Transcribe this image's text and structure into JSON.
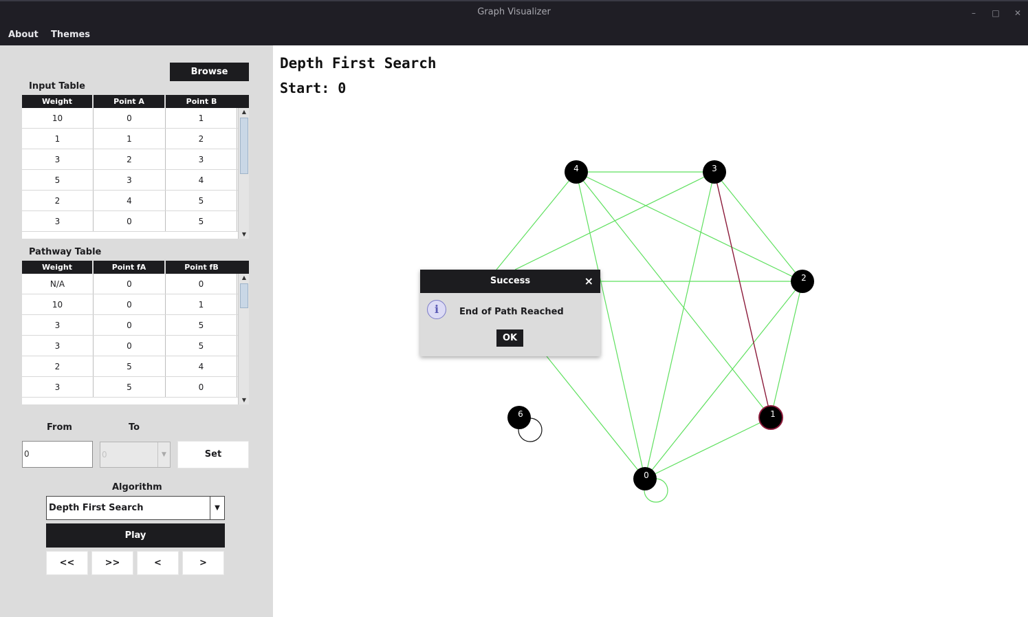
{
  "window": {
    "title": "Graph Visualizer"
  },
  "menu": {
    "about": "About",
    "themes": "Themes"
  },
  "left_panel": {
    "browse_label": "Browse",
    "input_table": {
      "title": "Input Table",
      "columns": [
        "Weight",
        "Point A",
        "Point B"
      ],
      "rows": [
        [
          "10",
          "0",
          "1"
        ],
        [
          "1",
          "1",
          "2"
        ],
        [
          "3",
          "2",
          "3"
        ],
        [
          "5",
          "3",
          "4"
        ],
        [
          "2",
          "4",
          "5"
        ],
        [
          "3",
          "0",
          "5"
        ]
      ]
    },
    "pathway_table": {
      "title": "Pathway Table",
      "columns": [
        "Weight",
        "Point fA",
        "Point fB"
      ],
      "rows": [
        [
          "N/A",
          "0",
          "0"
        ],
        [
          "10",
          "0",
          "1"
        ],
        [
          "3",
          "0",
          "5"
        ],
        [
          "3",
          "0",
          "5"
        ],
        [
          "2",
          "5",
          "4"
        ],
        [
          "3",
          "5",
          "0"
        ]
      ]
    },
    "from_label": "From",
    "to_label": "To",
    "from_value": "0",
    "to_value": "0",
    "set_label": "Set",
    "algorithm_label": "Algorithm",
    "algorithm_selected": "Depth First Search",
    "play_label": "Play",
    "nav_buttons": [
      "<<",
      ">>",
      "<",
      ">"
    ]
  },
  "canvas": {
    "heading": "Depth First Search",
    "start_text": "Start: 0",
    "nodes": [
      "0",
      "1",
      "2",
      "3",
      "4",
      "6"
    ],
    "colors": {
      "edge": "#5ee05e",
      "highlight_edge": "#8b1a3a",
      "node": "#000000",
      "highlight_node": "#8b1a3a"
    }
  },
  "dialog": {
    "title": "Success",
    "message": "End of Path Reached",
    "ok_label": "OK",
    "close_glyph": "×",
    "icon": "info-icon"
  }
}
